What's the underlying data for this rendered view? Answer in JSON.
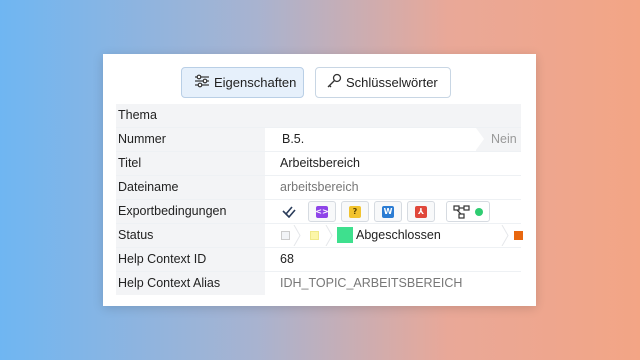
{
  "tabs": [
    {
      "label": "Eigenschaften",
      "icon": "sliders-icon",
      "active": true
    },
    {
      "label": "Schlüsselwörter",
      "icon": "key-icon",
      "active": false
    }
  ],
  "rows": {
    "thema": {
      "label": "Thema"
    },
    "nummer": {
      "label": "Nummer",
      "value": "B.5.",
      "flag": "Nein"
    },
    "titel": {
      "label": "Titel",
      "value": "Arbeitsbereich"
    },
    "dateiname": {
      "label": "Dateiname",
      "value": "arbeitsbereich"
    },
    "export": {
      "label": "Exportbedingungen",
      "icons": [
        {
          "name": "checklist-icon"
        },
        {
          "name": "html-code-icon",
          "color": "#8e44e8",
          "glyph": "<>"
        },
        {
          "name": "help-file-icon",
          "color": "#f2c32e",
          "glyph": "?"
        },
        {
          "name": "word-icon",
          "color": "#2b7cd3",
          "glyph": "W"
        },
        {
          "name": "pdf-icon",
          "color": "#e0483b",
          "glyph": "⅄"
        },
        {
          "name": "workflow-icon",
          "status_color": "#2ecc71"
        }
      ]
    },
    "status": {
      "label": "Status",
      "value": "Abgeschlossen",
      "colors": {
        "step1": "#f2f4f7",
        "step2": "#fcf6a8",
        "current": "#3ee08e",
        "end": "#e8670f"
      }
    },
    "help_id": {
      "label": "Help Context ID",
      "value": "68"
    },
    "help_alias": {
      "label": "Help Context Alias",
      "value": "IDH_TOPIC_ARBEITSBEREICH"
    }
  }
}
